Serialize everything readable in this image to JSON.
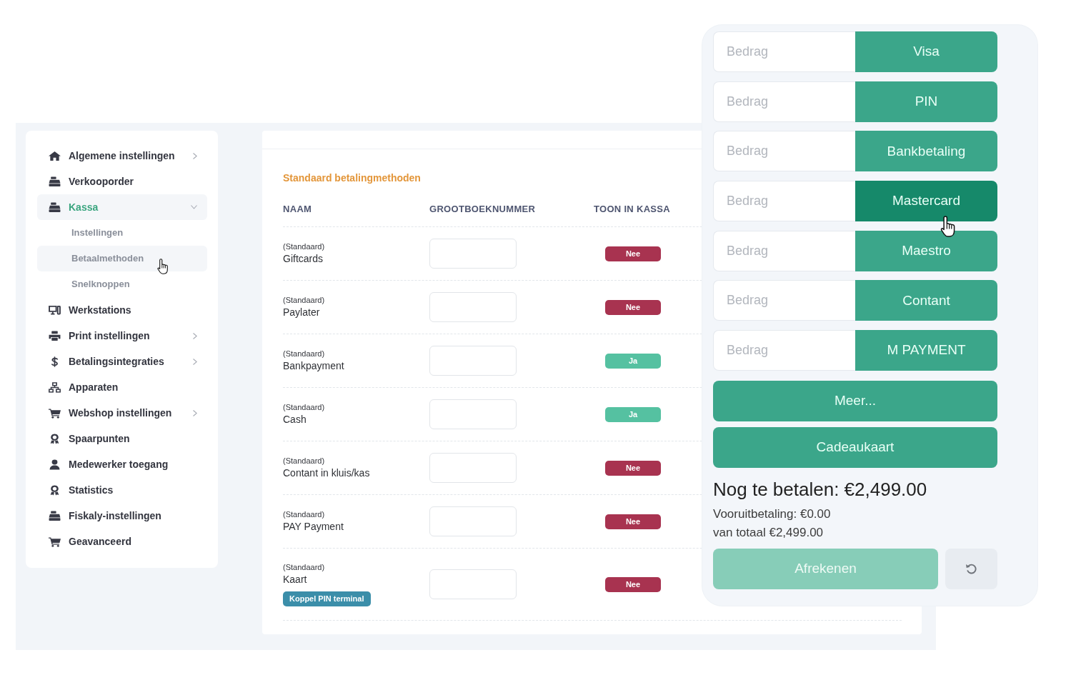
{
  "sidebar": {
    "items": [
      {
        "label": "Algemene instellingen",
        "kind": "group",
        "expanded": false,
        "selected": false
      },
      {
        "label": "Verkooporder",
        "kind": "link",
        "selected": false
      },
      {
        "label": "Kassa",
        "kind": "group",
        "expanded": true,
        "selected": true,
        "children": [
          {
            "label": "Instellingen",
            "hovered": false
          },
          {
            "label": "Betaalmethoden",
            "hovered": true
          },
          {
            "label": "Snelknoppen",
            "hovered": false
          }
        ]
      },
      {
        "label": "Werkstations",
        "kind": "link",
        "selected": false
      },
      {
        "label": "Print instellingen",
        "kind": "group",
        "expanded": false,
        "selected": false
      },
      {
        "label": "Betalingsintegraties",
        "kind": "group",
        "expanded": false,
        "selected": false
      },
      {
        "label": "Apparaten",
        "kind": "link",
        "selected": false
      },
      {
        "label": "Webshop instellingen",
        "kind": "group",
        "expanded": false,
        "selected": false
      },
      {
        "label": "Spaarpunten",
        "kind": "link",
        "selected": false
      },
      {
        "label": "Medewerker toegang",
        "kind": "link",
        "selected": false
      },
      {
        "label": "Statistics",
        "kind": "link",
        "selected": false
      },
      {
        "label": "Fiskaly-instellingen",
        "kind": "link",
        "selected": false
      },
      {
        "label": "Geavanceerd",
        "kind": "link",
        "selected": false
      }
    ]
  },
  "main": {
    "section_title": "Standaard betalingmethoden",
    "table": {
      "columns": [
        "NAAM",
        "GROOTBOEKNUMMER",
        "TOON IN KASSA"
      ],
      "rows": [
        {
          "tag": "(Standaard)",
          "name": "Giftcards",
          "show": {
            "label": "Nee",
            "on": false
          }
        },
        {
          "tag": "(Standaard)",
          "name": "Paylater",
          "show": {
            "label": "Nee",
            "on": false
          }
        },
        {
          "tag": "(Standaard)",
          "name": "Bankpayment",
          "show": {
            "label": "Ja",
            "on": true
          }
        },
        {
          "tag": "(Standaard)",
          "name": "Cash",
          "show": {
            "label": "Ja",
            "on": true
          }
        },
        {
          "tag": "(Standaard)",
          "name": "Contant in kluis/kas",
          "show": {
            "label": "Nee",
            "on": false
          }
        },
        {
          "tag": "(Standaard)",
          "name": "PAY Payment",
          "show": {
            "label": "Nee",
            "on": false
          }
        },
        {
          "tag": "(Standaard)",
          "name": "Kaart",
          "action": "Koppel PIN terminal",
          "show": {
            "label": "Nee",
            "on": false
          }
        }
      ]
    }
  },
  "payment": {
    "methods": [
      {
        "placeholder": "Bedrag",
        "label": "Visa",
        "hovered": false
      },
      {
        "placeholder": "Bedrag",
        "label": "PIN",
        "hovered": false
      },
      {
        "placeholder": "Bedrag",
        "label": "Bankbetaling",
        "hovered": false
      },
      {
        "placeholder": "Bedrag",
        "label": "Mastercard",
        "hovered": true
      },
      {
        "placeholder": "Bedrag",
        "label": "Maestro",
        "hovered": false
      },
      {
        "placeholder": "Bedrag",
        "label": "Contant",
        "hovered": false
      },
      {
        "placeholder": "Bedrag",
        "label": "M PAYMENT",
        "hovered": false
      }
    ],
    "more_button": "Meer...",
    "giftcard_button": "Cadeaukaart",
    "remaining": "Nog te betalen: €2,499.00",
    "prepayment": "Vooruitbetaling: €0.00",
    "total": "van totaal €2,499.00",
    "checkout": {
      "label": "Afrekenen",
      "disabled": true
    }
  }
}
